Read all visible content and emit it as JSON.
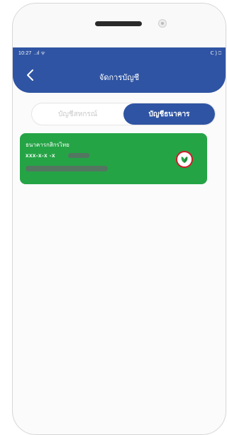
{
  "status_bar": {
    "time": "10:27",
    "signal": "..ıl ᯤ",
    "battery": "ᑕ ) ⎕"
  },
  "header": {
    "title": "จัดการบัญชี"
  },
  "tabs": [
    {
      "label": "บัญชีสหกรณ์",
      "active": false
    },
    {
      "label": "บัญชีธนาคาร",
      "active": true
    }
  ],
  "account_card": {
    "bank_name": "ธนาคารกสิกรไทย",
    "account_number": "xxx-x-x        -x",
    "color": "#25a446"
  },
  "colors": {
    "primary": "#2f54a3",
    "bank_green": "#25a446",
    "logo_red": "#d01a2a"
  },
  "icons": {
    "back": "chevron-left-icon",
    "bank_logo": "kbank-leaf-icon"
  }
}
